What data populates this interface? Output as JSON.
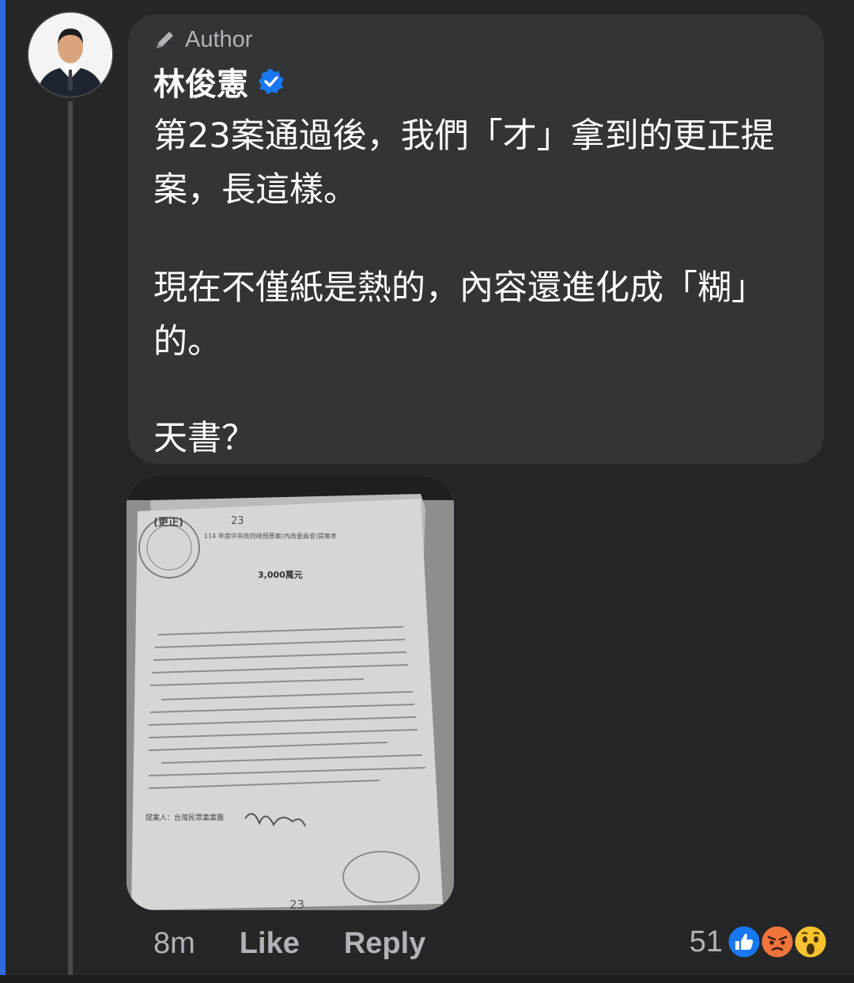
{
  "comment": {
    "badge_label": "Author",
    "author_name": "林俊憲",
    "paragraphs": [
      "第23案通過後，我們「才」拿到的更正提案，長這樣。",
      "現在不僅紙是熱的，內容還進化成「糊」的。",
      "天書？"
    ],
    "timestamp": "8m",
    "like_label": "Like",
    "reply_label": "Reply",
    "reaction_count": "51",
    "reactions": [
      "like-icon",
      "angry-icon",
      "wow-icon"
    ]
  },
  "attachment": {
    "doc_top": "(更正)",
    "doc_number": "23",
    "doc_title": "114 年度中央政府總預算案(內政委員會)提案表",
    "doc_amount": "3,000萬元",
    "doc_proposer": "提案人：台灣民眾黨黨團",
    "doc_bottom_number": "23"
  },
  "colors": {
    "background": "#252628",
    "bubble": "#333436",
    "accent": "#2d6ae0",
    "verified": "#1877f2"
  }
}
